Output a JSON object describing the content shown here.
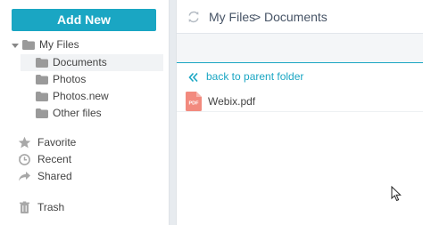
{
  "sidebar": {
    "add_new_label": "Add New",
    "tree": {
      "root_label": "My Files",
      "children": [
        {
          "label": "Documents",
          "selected": true
        },
        {
          "label": "Photos",
          "selected": false
        },
        {
          "label": "Photos.new",
          "selected": false
        },
        {
          "label": "Other files",
          "selected": false
        }
      ]
    },
    "shortcuts": [
      {
        "label": "Favorite",
        "icon": "star-icon"
      },
      {
        "label": "Recent",
        "icon": "clock-icon"
      },
      {
        "label": "Shared",
        "icon": "share-icon"
      }
    ],
    "trash_label": "Trash"
  },
  "main": {
    "breadcrumb": [
      "My Files",
      "Documents"
    ],
    "breadcrumb_separator": ">",
    "back_label": "back to parent folder",
    "files": [
      {
        "name": "Webix.pdf",
        "icon_text": "PDF"
      }
    ]
  },
  "colors": {
    "accent": "#1aa6c3",
    "pdf": "#f28a7e",
    "folder": "#9a9a9a"
  }
}
